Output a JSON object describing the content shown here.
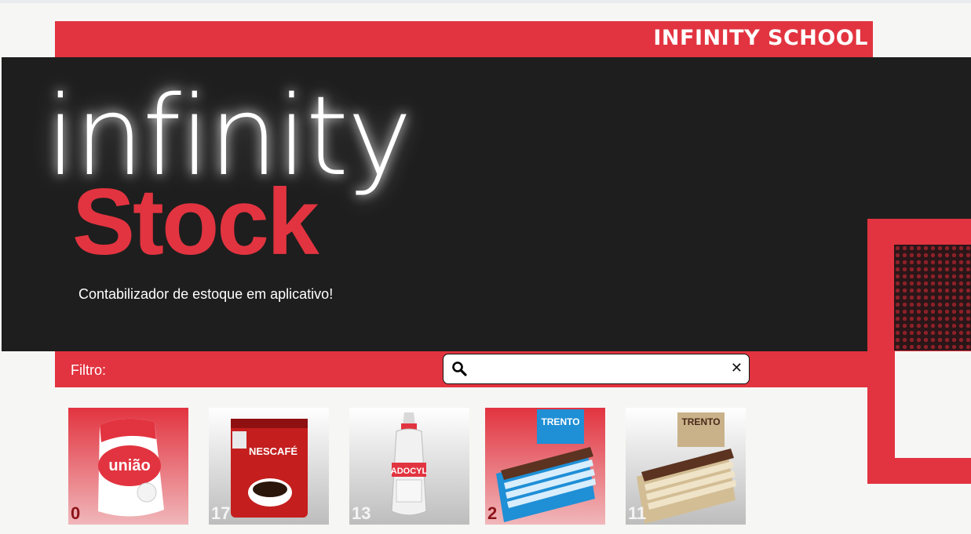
{
  "header": {
    "brand": "INFINITY SCHOOL"
  },
  "hero": {
    "title_top": "infinity",
    "title_bottom": "Stock",
    "tagline": "Contabilizador de estoque em aplicativo!"
  },
  "filter": {
    "label": "Filtro:",
    "search_value": "",
    "search_placeholder": "",
    "clear_icon": "close-icon",
    "search_icon": "search-icon"
  },
  "colors": {
    "accent": "#e23440",
    "hero_bg": "#1e1e1e",
    "page_bg": "#f6f6f4"
  },
  "products": [
    {
      "name": "União Refinado sugar",
      "package_text": "união",
      "qty": "0",
      "bg": "red"
    },
    {
      "name": "Nescafé Forte",
      "package_text": "NESCAFÉ",
      "qty": "17",
      "bg": "grey"
    },
    {
      "name": "Adocyl sweetener",
      "package_text": "ADOCYL",
      "qty": "13",
      "bg": "grey"
    },
    {
      "name": "Trento Milk box",
      "package_text": "TRENTO",
      "qty": "2",
      "bg": "red"
    },
    {
      "name": "Trento Blanco box",
      "package_text": "TRENTO",
      "qty": "11",
      "bg": "grey"
    }
  ]
}
